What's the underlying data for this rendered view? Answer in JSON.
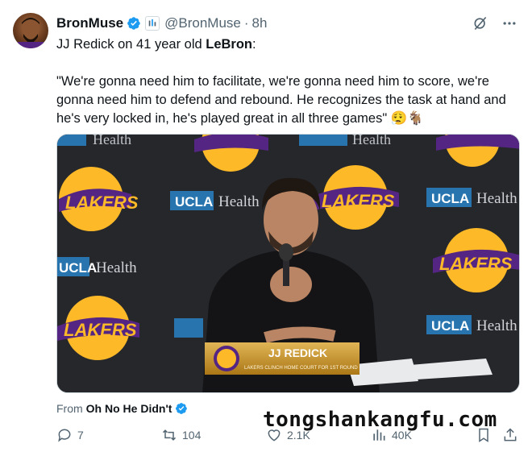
{
  "post": {
    "author_name": "BronMuse",
    "handle": "@BronMuse",
    "separator": "·",
    "time": "8h",
    "text_line1_prefix": "JJ Redick on 41 year old ",
    "text_line1_bold": "LeBron",
    "text_line1_suffix": ":",
    "quote": "\"We're gonna need him to facilitate, we're gonna need him to score, we're gonna need him to defend and rebound. He recognizes the task at hand and he's very locked in, he's played great in all three games\" 😮‍💨🐐"
  },
  "media": {
    "lower_third_name": "JJ REDICK",
    "lower_third_sub": "LAKERS CLINCH HOME COURT FOR 1ST ROUND",
    "sponsor_ucla": "UCLA",
    "sponsor_health": "Health",
    "logo_text": "LAKERS",
    "logo_small": "LOS ANGELES"
  },
  "source": {
    "prefix": "From",
    "name": "Oh No He Didn't"
  },
  "watermark": "tongshankangfu.com",
  "engagement": {
    "replies": "7",
    "reposts": "104",
    "likes": "2.1K",
    "views": "40K"
  },
  "colors": {
    "verified_blue": "#1d9bf0",
    "lakers_purple": "#552583",
    "lakers_gold": "#fdb927",
    "ucla_blue": "#2774ae"
  }
}
